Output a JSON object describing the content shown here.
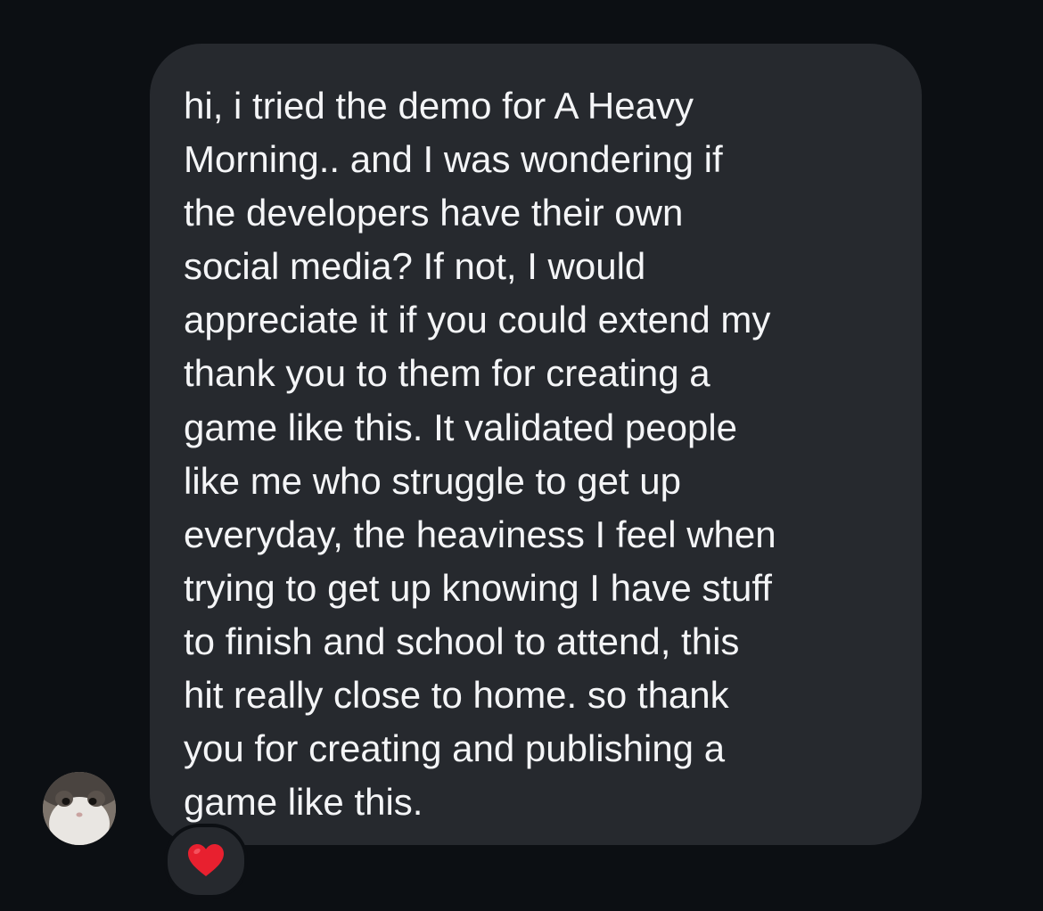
{
  "message": {
    "lines": [
      "hi, i tried the demo for A Heavy",
      "Morning.. and I was wondering if",
      "the developers have their own",
      "social media? If not, I would",
      "appreciate it if you could extend my",
      "thank you to them for creating a",
      "game like this. It validated people",
      "like me who struggle to get up",
      "everyday, the heaviness I feel when",
      "trying to get up knowing I have stuff",
      "to finish and school to attend, this",
      "hit really close to home. so thank",
      "you for creating and publishing a",
      "game like this."
    ],
    "bubble_color": "#26292e",
    "text_color": "#f4f5f7"
  },
  "reaction": {
    "icon": "red-heart-icon",
    "color": "#e8202f"
  },
  "sender": {
    "avatar_icon": "cat-avatar"
  },
  "background_color": "#0c0f13"
}
